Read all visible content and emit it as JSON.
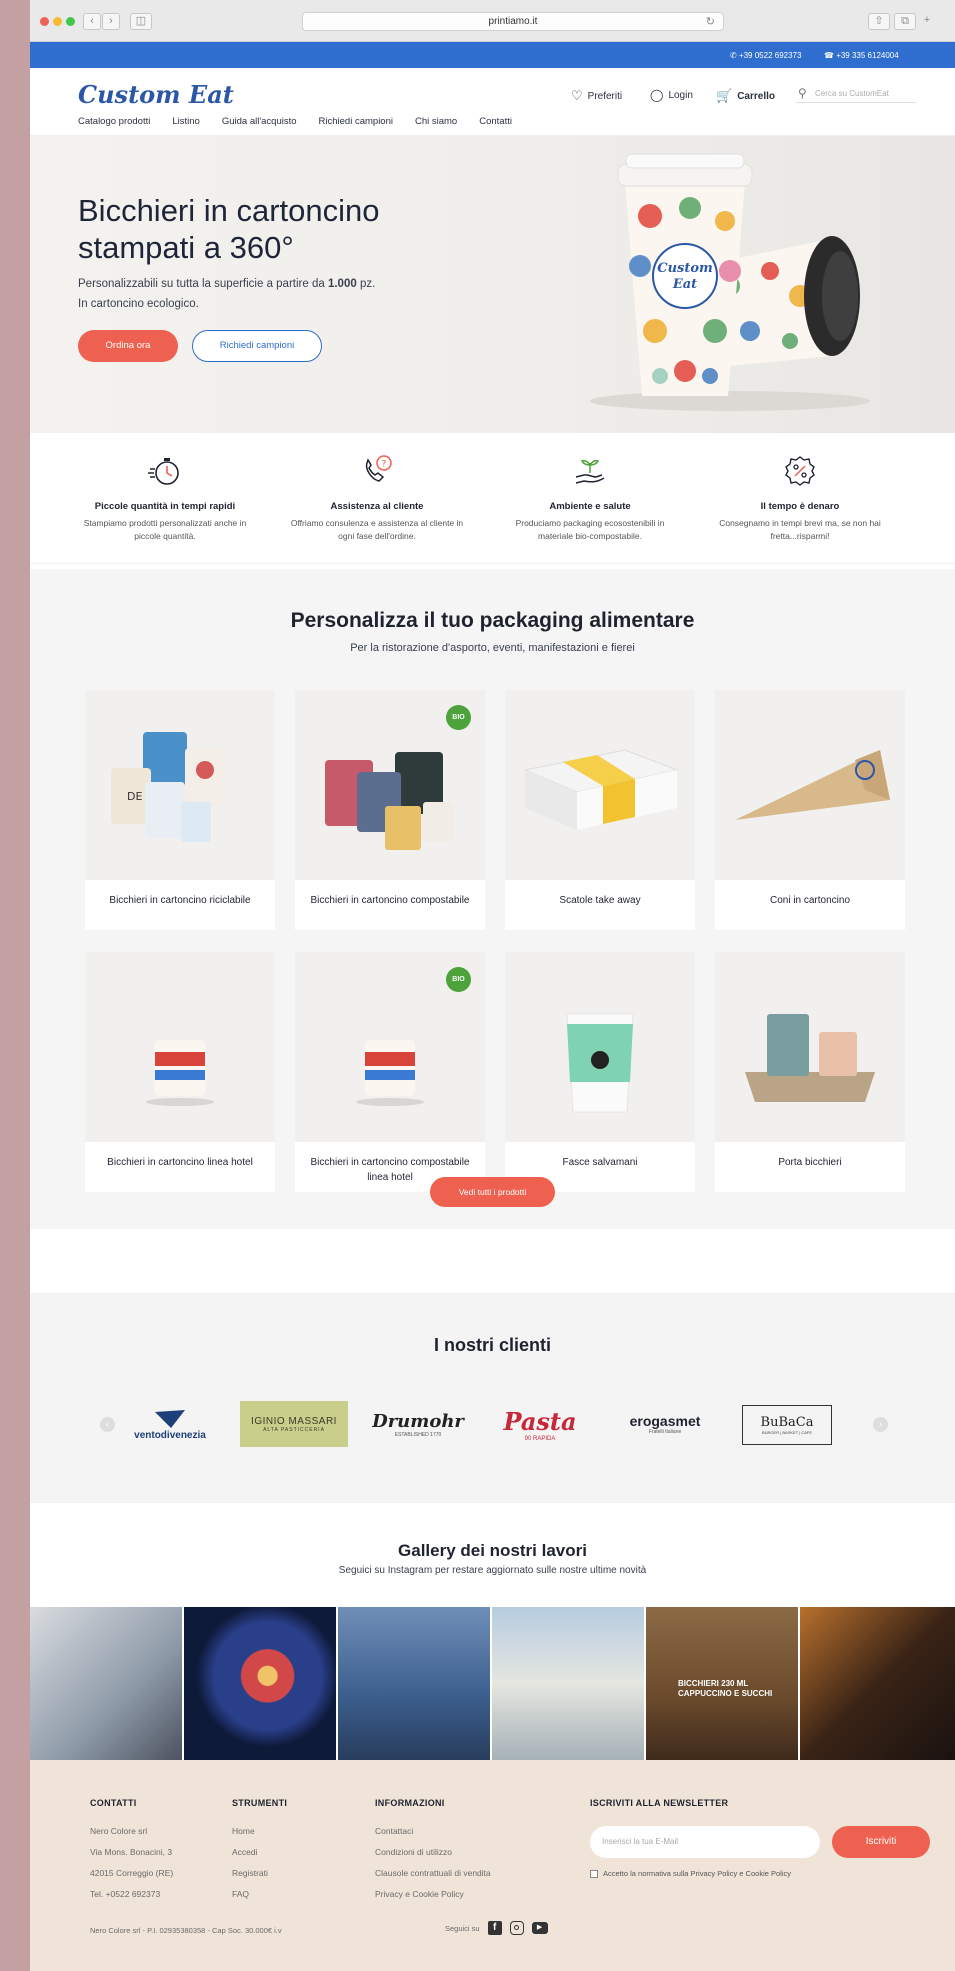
{
  "browser": {
    "url": "printiamo.it"
  },
  "topbar": {
    "phone": "+39 0522 692373",
    "whatsapp": "+39 335 6124004"
  },
  "header": {
    "logo": "Custom Eat",
    "favorites": "Preferiti",
    "login": "Login",
    "cart": "Carrello",
    "search_placeholder": "Cerca su CustomEat",
    "nav": [
      "Catalogo prodotti",
      "Listino",
      "Guida all'acquisto",
      "Richiedi campioni",
      "Chi siamo",
      "Contatti"
    ]
  },
  "hero": {
    "title": "Bicchieri in cartoncino stampati a 360°",
    "text_1": "Personalizzabili su tutta la superficie a partire da",
    "text_qty": "1.000",
    "text_2": "pz.",
    "text_3": "In cartoncino ecologico.",
    "cta_primary": "Ordina ora",
    "cta_secondary": "Richiedi campioni",
    "cup_logo": "Custom Eat"
  },
  "features": [
    {
      "icon": "stopwatch-icon",
      "title": "Piccole quantità in tempi rapidi",
      "desc": "Stampiamo prodotti personalizzati anche in piccole quantità."
    },
    {
      "icon": "phone-support-icon",
      "title": "Assistenza al cliente",
      "desc": "Offriamo consulenza e assistenza al cliente in ogni fase dell'ordine."
    },
    {
      "icon": "plant-hand-icon",
      "title": "Ambiente e salute",
      "desc": "Produciamo packaging ecosostenibili in materiale bio-compostabile."
    },
    {
      "icon": "discount-badge-icon",
      "title": "Il tempo è denaro",
      "desc": "Consegnamo in tempi brevi ma, se non hai fretta...risparmi!"
    }
  ],
  "products": {
    "title": "Personalizza il tuo packaging alimentare",
    "subtitle": "Per la ristorazione d'asporto, eventi, manifestazioni e fierei",
    "items": [
      {
        "label": "Bicchieri in cartoncino riciclabile",
        "bio": false
      },
      {
        "label": "Bicchieri in cartoncino compostabile",
        "bio": true
      },
      {
        "label": "Scatole take away",
        "bio": false
      },
      {
        "label": "Coni in cartoncino",
        "bio": false
      },
      {
        "label": "Bicchieri in cartoncino linea hotel",
        "bio": false
      },
      {
        "label": "Bicchieri in cartoncino compostabile linea hotel",
        "bio": true
      },
      {
        "label": "Fasce salvamani",
        "bio": false
      },
      {
        "label": "Porta bicchieri",
        "bio": false
      }
    ],
    "bio_badge": "BIO",
    "view_all": "Vedi tutti i prodotti"
  },
  "clients": {
    "title": "I nostri clienti",
    "logos": [
      "ventodivenezia",
      "IGINIO MASSARI",
      "Drumohr",
      "Pasta",
      "erogasmet",
      "BuBaCa"
    ],
    "logo_sub": {
      "iginio": "ALTA PASTICCERIA",
      "drumohr": "ESTABLISHED 1770",
      "pasta": "90 RAPIDA",
      "erogasmet": "Fratelli Italiane",
      "bubaca": "BURGER | BASKET | CAFE"
    }
  },
  "gallery": {
    "title": "Gallery dei nostri lavori",
    "subtitle": "Seguici su Instagram per restare aggiornato sulle nostre ultime novità",
    "caption_5": "BICCHIERI 230 ML CAPPUCCINO E SUCCHI"
  },
  "footer": {
    "contacts": {
      "title": "CONTATTI",
      "lines": [
        "Nero Colore srl",
        "Via Mons. Bonacini, 3",
        "42015 Correggio (RE)",
        "Tel. +0522 692373"
      ]
    },
    "tools": {
      "title": "STRUMENTI",
      "lines": [
        "Home",
        "Accedi",
        "Registrati",
        "FAQ"
      ]
    },
    "info": {
      "title": "INFORMAZIONI",
      "lines": [
        "Contattaci",
        "Condizioni di utilizzo",
        "Clausole contrattuali di vendita",
        "Privacy e Cookie Policy"
      ]
    },
    "newsletter": {
      "title": "ISCRIVITI ALLA NEWSLETTER",
      "placeholder": "Inserisci la tua E-Mail",
      "button": "Iscriviti",
      "consent": "Accetto la normativa sulla Privacy Policy e Cookie Policy"
    },
    "legal": "Nero Colore srl - P.I. 02935380358 - Cap Soc. 30.000€ i.v",
    "follow": "Seguici su"
  },
  "colors": {
    "brand_blue": "#2f6dce",
    "accent_red": "#ee6150",
    "footer_bg": "#f0e4d8"
  }
}
